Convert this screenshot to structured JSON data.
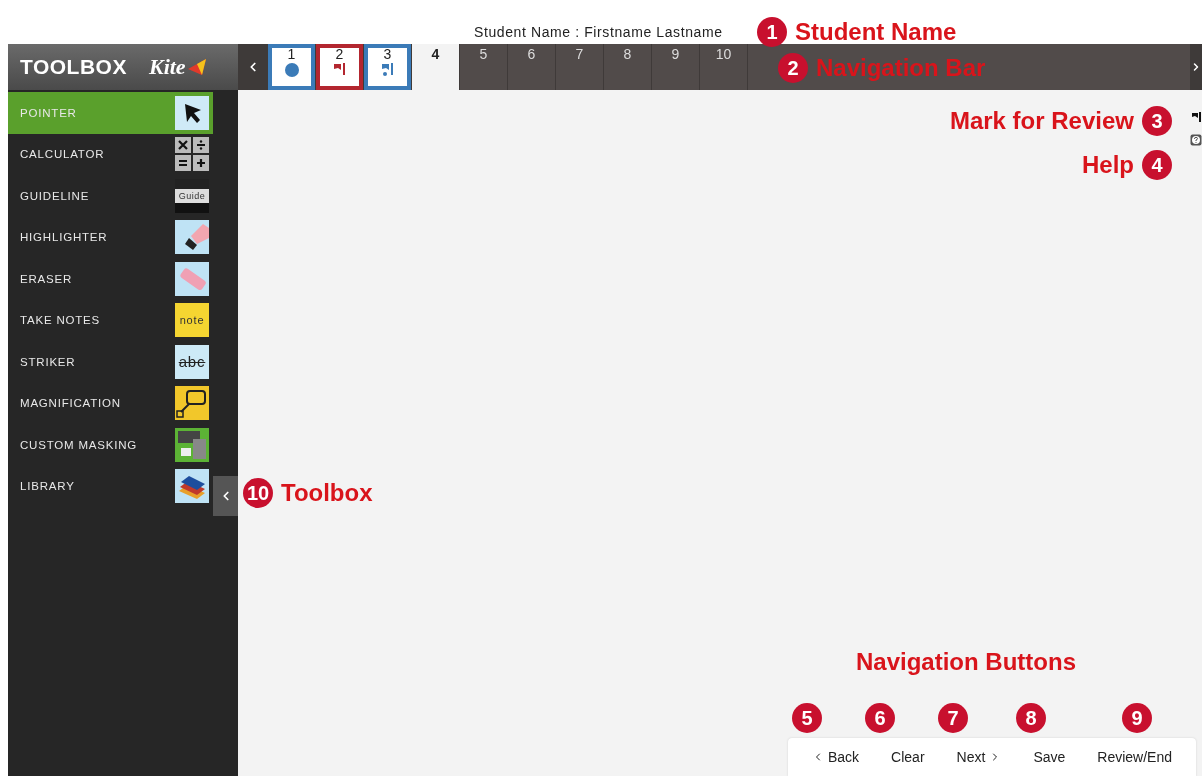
{
  "student_name": "Student Name : Firstname Lastname",
  "toolbox": {
    "title": "TOOLBOX",
    "logo": "Kite",
    "tools": [
      {
        "label": "POINTER",
        "kind": "pointer",
        "selected": true
      },
      {
        "label": "CALCULATOR",
        "kind": "calculator",
        "selected": false
      },
      {
        "label": "GUIDELINE",
        "kind": "guideline",
        "selected": false,
        "icon_text": "Guide"
      },
      {
        "label": "HIGHLIGHTER",
        "kind": "highlighter",
        "selected": false
      },
      {
        "label": "ERASER",
        "kind": "eraser",
        "selected": false
      },
      {
        "label": "TAKE NOTES",
        "kind": "notes",
        "selected": false,
        "icon_text": "note"
      },
      {
        "label": "STRIKER",
        "kind": "striker",
        "selected": false,
        "icon_text": "abc"
      },
      {
        "label": "MAGNIFICATION",
        "kind": "magnifier",
        "selected": false
      },
      {
        "label": "CUSTOM MASKING",
        "kind": "masking",
        "selected": false
      },
      {
        "label": "LIBRARY",
        "kind": "library",
        "selected": false
      }
    ]
  },
  "questions": [
    {
      "number": "1",
      "answered": true,
      "flagged": false,
      "selected": false
    },
    {
      "number": "2",
      "answered": false,
      "flagged": true,
      "selected": false
    },
    {
      "number": "3",
      "answered": true,
      "flagged": true,
      "selected": false
    },
    {
      "number": "4",
      "answered": false,
      "flagged": false,
      "selected": true
    },
    {
      "number": "5",
      "answered": false,
      "flagged": false,
      "selected": false
    },
    {
      "number": "6",
      "answered": false,
      "flagged": false,
      "selected": false
    },
    {
      "number": "7",
      "answered": false,
      "flagged": false,
      "selected": false
    },
    {
      "number": "8",
      "answered": false,
      "flagged": false,
      "selected": false
    },
    {
      "number": "9",
      "answered": false,
      "flagged": false,
      "selected": false
    },
    {
      "number": "10",
      "answered": false,
      "flagged": false,
      "selected": false
    }
  ],
  "footer_buttons": [
    {
      "label": "Back",
      "kind": "back"
    },
    {
      "label": "Clear",
      "kind": "plain"
    },
    {
      "label": "Next",
      "kind": "next"
    },
    {
      "label": "Save",
      "kind": "plain"
    },
    {
      "label": "Review/End",
      "kind": "plain"
    }
  ],
  "callouts": [
    {
      "number": "1",
      "label": "Student Name"
    },
    {
      "number": "2",
      "label": "Navigation Bar"
    },
    {
      "number": "3",
      "label": "Mark for Review"
    },
    {
      "number": "4",
      "label": "Help"
    },
    {
      "label": "Navigation Buttons"
    },
    {
      "number": "5"
    },
    {
      "number": "6"
    },
    {
      "number": "7"
    },
    {
      "number": "8"
    },
    {
      "number": "9"
    },
    {
      "number": "10",
      "label": "Toolbox"
    }
  ]
}
